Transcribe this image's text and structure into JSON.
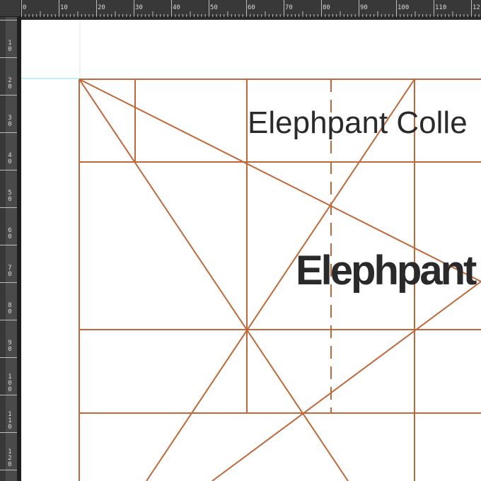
{
  "rulers": {
    "top_labels": [
      "0",
      "10",
      "20",
      "30",
      "40",
      "50",
      "60",
      "70",
      "80",
      "90",
      "100",
      "110",
      "12"
    ],
    "left_labels": [
      "1 0",
      "2 0",
      "3 0",
      "4 0",
      "5 0",
      "6 0",
      "7 0",
      "8 0",
      "9 0",
      "1 0 0",
      "1 1 0",
      "1 2 0"
    ]
  },
  "document": {
    "subtitle": "Elephpant Colle",
    "title": "Elephpant"
  },
  "colors": {
    "guide_line": "#c0683a",
    "guide_cyan": "#7fe0e6",
    "ruler_bg": "#383838",
    "text": "#2a2a2a"
  }
}
